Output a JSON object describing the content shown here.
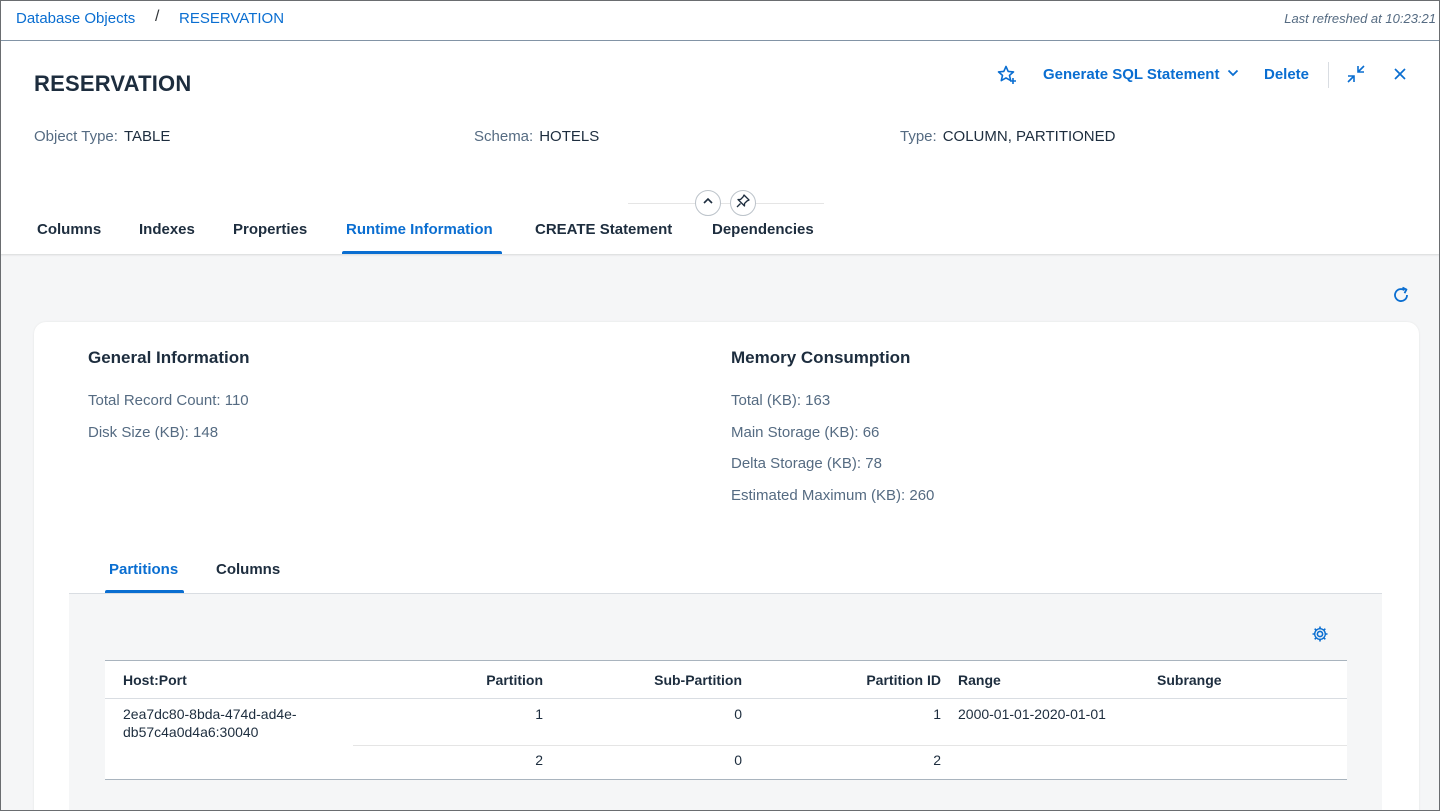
{
  "breadcrumb": {
    "items": [
      "Database Objects",
      "RESERVATION"
    ],
    "separator": "/"
  },
  "last_refreshed": "Last refreshed at 10:23:21",
  "header": {
    "title": "RESERVATION",
    "attributes": [
      {
        "label": "Object Type:",
        "value": "TABLE"
      },
      {
        "label": "Schema:",
        "value": "HOTELS"
      },
      {
        "label": "Type:",
        "value": "COLUMN, PARTITIONED"
      }
    ],
    "actions": {
      "generate_sql": "Generate SQL Statement",
      "delete": "Delete"
    },
    "icons": [
      "add-favorite-icon",
      "chevron-down-icon",
      "exit-full-screen-icon",
      "close-icon",
      "collapse-header-icon",
      "pin-icon",
      "refresh-icon",
      "settings-icon"
    ]
  },
  "tabs": [
    {
      "label": "Columns",
      "active": false
    },
    {
      "label": "Indexes",
      "active": false
    },
    {
      "label": "Properties",
      "active": false
    },
    {
      "label": "Runtime Information",
      "active": true
    },
    {
      "label": "CREATE Statement",
      "active": false
    },
    {
      "label": "Dependencies",
      "active": false
    }
  ],
  "general_info": {
    "title": "General Information",
    "items": [
      "Total Record Count: 110",
      "Disk Size (KB): 148"
    ]
  },
  "memory": {
    "title": "Memory Consumption",
    "items": [
      "Total (KB): 163",
      "Main Storage (KB): 66",
      "Delta Storage (KB): 78",
      "Estimated Maximum (KB): 260"
    ]
  },
  "subtabs": [
    {
      "label": "Partitions",
      "active": true
    },
    {
      "label": "Columns",
      "active": false
    }
  ],
  "partitions_table": {
    "columns": [
      "Host:Port",
      "Partition",
      "Sub-Partition",
      "Partition ID",
      "Range",
      "Subrange"
    ],
    "host_line1": "2ea7dc80-8bda-474d-ad4e-",
    "host_line2": "db57c4a0d4a6:30040",
    "rows": [
      {
        "partition": "1",
        "sub_partition": "0",
        "partition_id": "1",
        "range": "2000-01-01-2020-01-01",
        "subrange": ""
      },
      {
        "partition": "2",
        "sub_partition": "0",
        "partition_id": "2",
        "range": "",
        "subrange": ""
      }
    ]
  },
  "colors": {
    "accent": "#0a6ed1",
    "text": "#1d2d3e",
    "label": "#556b82",
    "background": "#f5f6f7"
  }
}
